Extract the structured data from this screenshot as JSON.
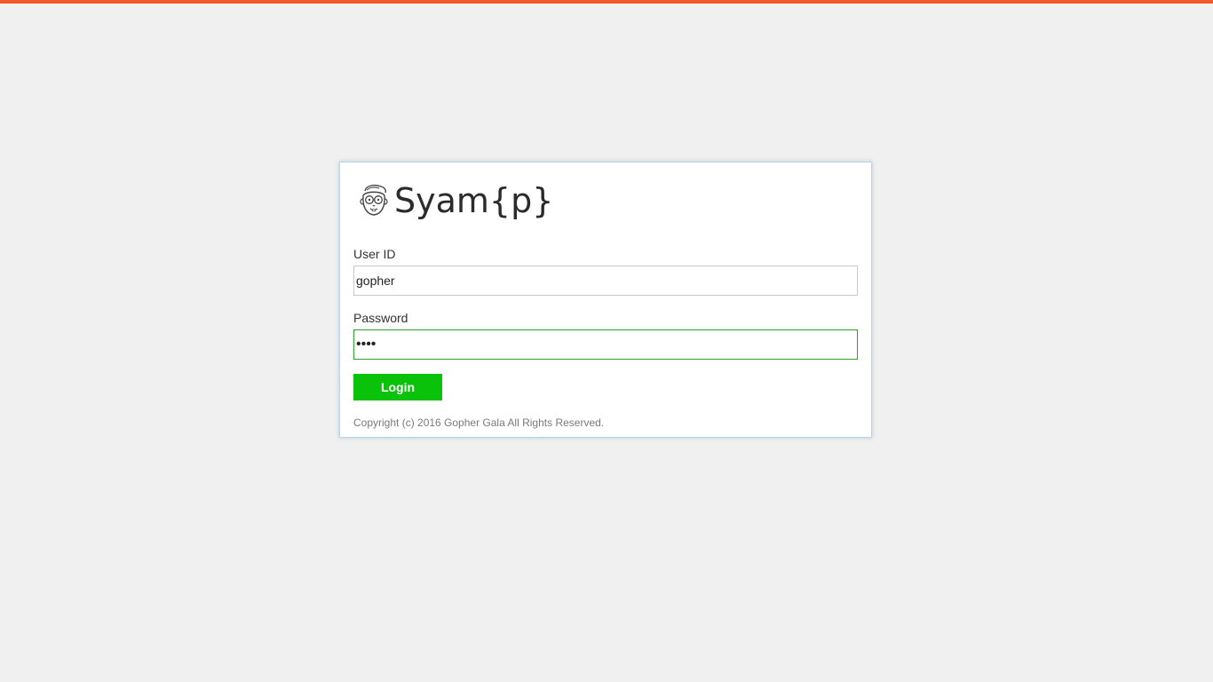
{
  "colors": {
    "top_bar": "#f05a28",
    "background": "#f0f0f0",
    "login_button": "#0ac20a",
    "focused_border": "#2aa52a"
  },
  "brand": {
    "logo_icon": "gopher-face-icon",
    "app_name": "Syam{p}"
  },
  "form": {
    "user_id": {
      "label": "User ID",
      "value": "gopher"
    },
    "password": {
      "label": "Password",
      "value": "gala",
      "focused": true
    },
    "login_label": "Login"
  },
  "footer": {
    "copyright": "Copyright (c) 2016 Gopher Gala All Rights Reserved."
  }
}
